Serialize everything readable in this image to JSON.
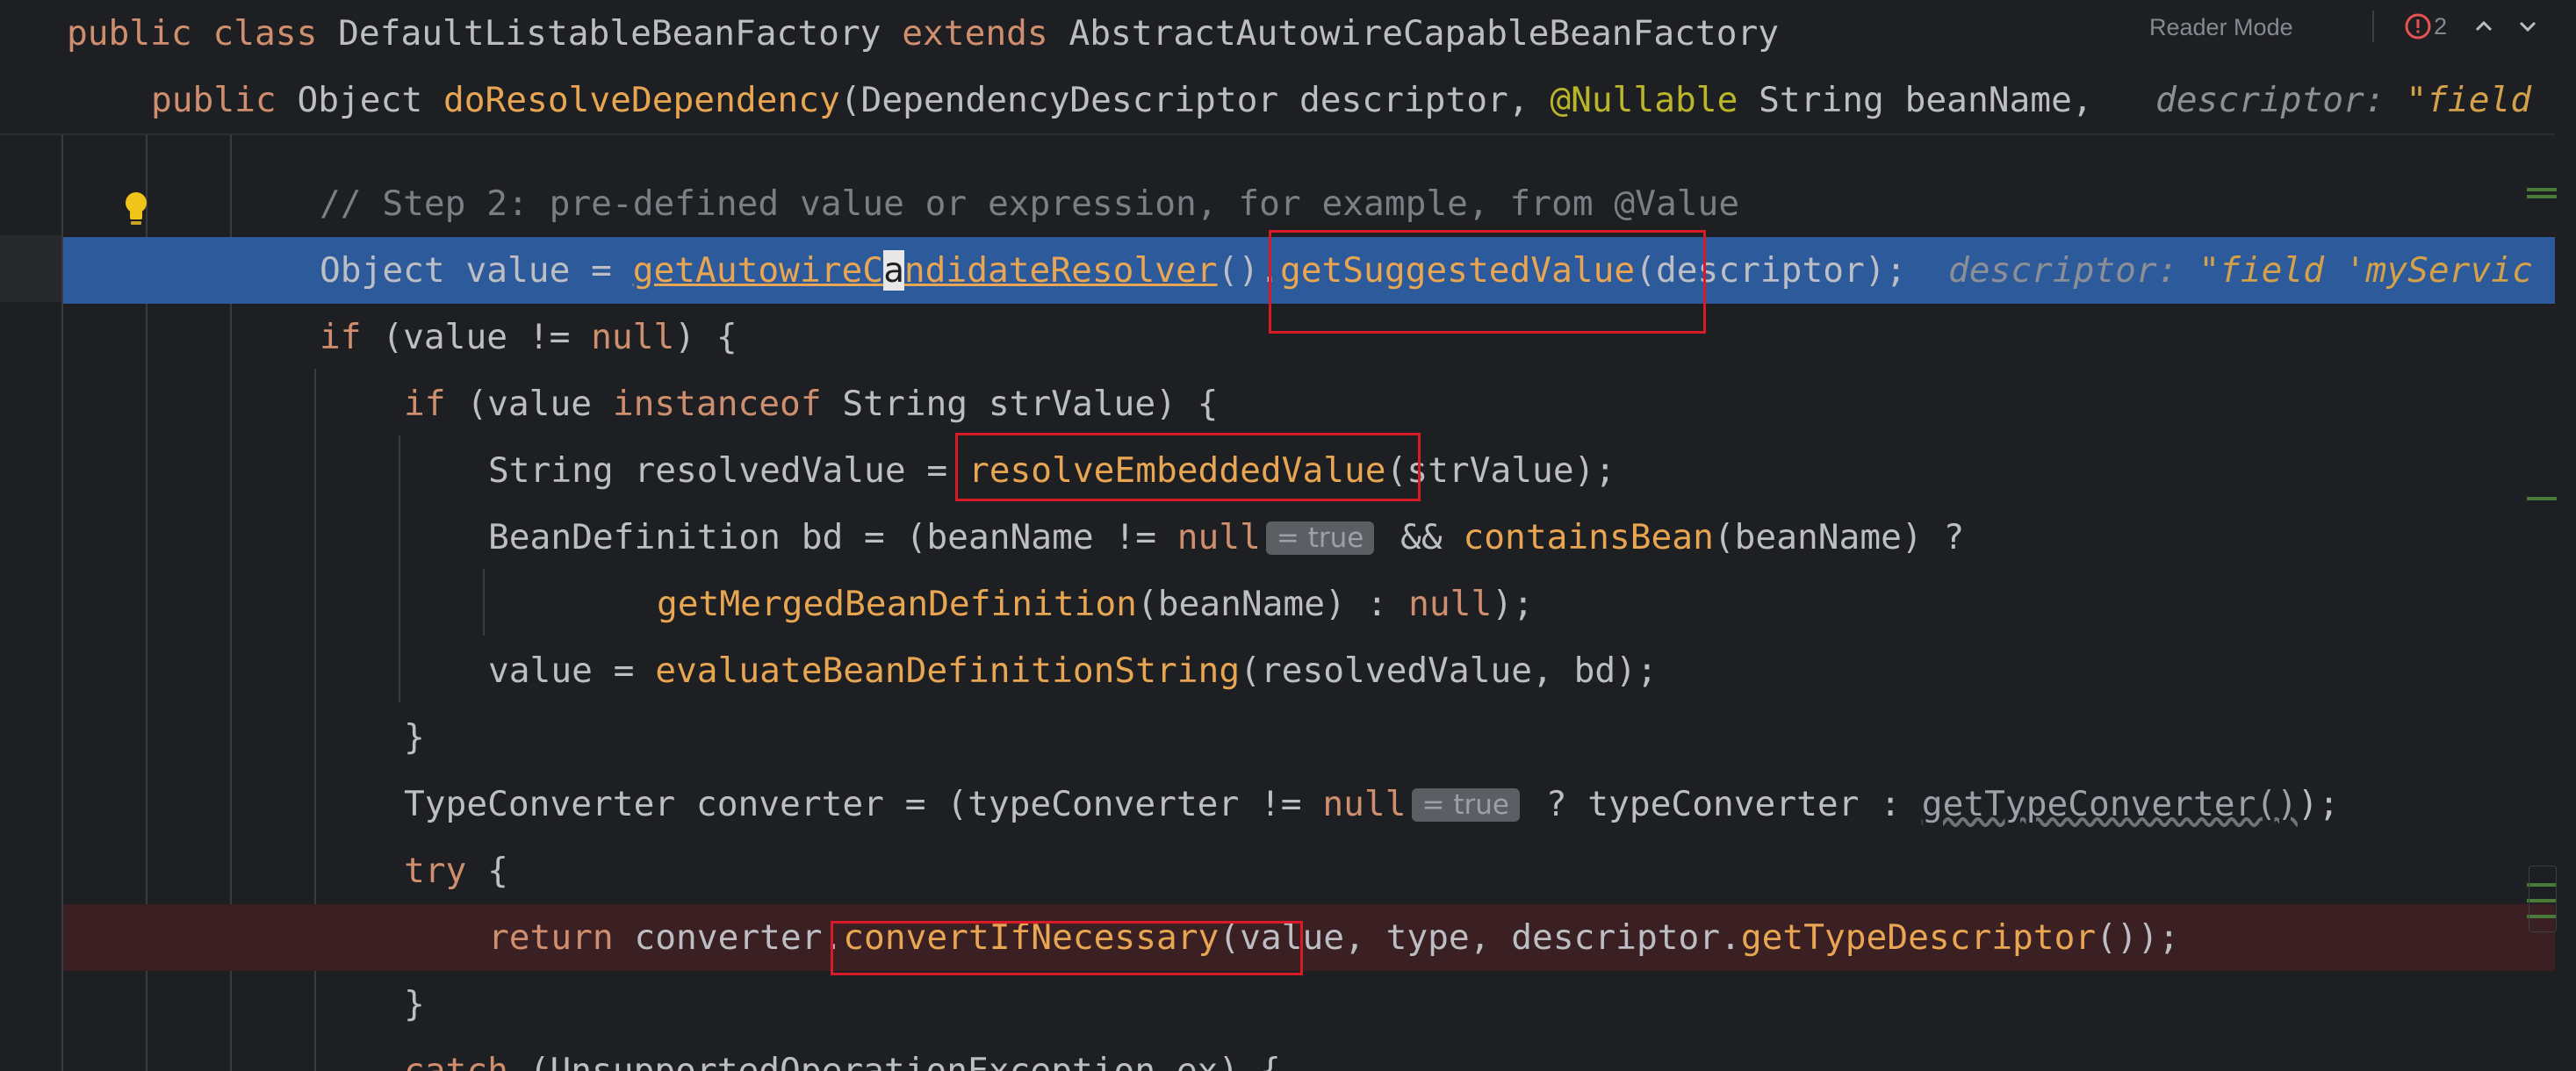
{
  "toolbar": {
    "reader_mode": "Reader Mode",
    "error_count": "2",
    "icons": {
      "error": "error-circle-icon",
      "up": "chevron-up-icon",
      "down": "chevron-down-icon",
      "bulb": "lightbulb-icon"
    }
  },
  "sticky": {
    "line1": {
      "kw1": "public",
      "kw2": "class",
      "name": " DefaultListableBeanFactory ",
      "kw3": "extends",
      "parent": " AbstractAutowireCapableBeanFactory"
    },
    "line2": {
      "kw1": "public",
      "t1": " Object ",
      "method": "doResolveDependency",
      "t2": "(DependencyDescriptor descriptor, ",
      "ann": "@Nullable",
      "t3": " String beanName,",
      "hint_label": "descriptor: ",
      "hint_value": "\"field"
    }
  },
  "code": {
    "l1": {
      "comment": "// Step 2: pre-defined value or expression, for example, from @Value"
    },
    "l2": {
      "t1": "Object value = ",
      "fn1a": "getAutowireC",
      "cursor": "a",
      "fn1b": "ndidateResolver",
      "t2": "()",
      "t3": ".",
      "fn2": "getSuggestedValue",
      "t4": "(descriptor);",
      "hint_label": "descriptor: ",
      "hint_value": "\"field 'myServic"
    },
    "l3": {
      "kw": "if",
      "t1": " (value != ",
      "kw2": "null",
      "t2": ") {"
    },
    "l4": {
      "kw": "if",
      "t1": " (value ",
      "kw2": "instanceof",
      "t2": " String strValue) {"
    },
    "l5": {
      "t1": "String resolvedValue = ",
      "fn": "resolveEmbeddedValue",
      "t2": "(strValue);"
    },
    "l6": {
      "t1": "BeanDefinition bd = (beanName != ",
      "kw": "null",
      "chip": "= true",
      "t2": " && ",
      "fn": "containsBean",
      "t3": "(beanName) ?"
    },
    "l7": {
      "fn": "getMergedBeanDefinition",
      "t1": "(beanName) : ",
      "kw": "null",
      "t2": ");"
    },
    "l8": {
      "t1": "value = ",
      "fn": "evaluateBeanDefinitionString",
      "t2": "(resolvedValue, bd);"
    },
    "l9": {
      "t1": "}"
    },
    "l10": {
      "t1": "TypeConverter converter = (typeConverter != ",
      "kw": "null",
      "chip": "= true",
      "t2": " ? typeConverter : ",
      "dep": "getTypeConverter()",
      "t3": ");"
    },
    "l11": {
      "kw": "try",
      "t1": " {"
    },
    "l12": {
      "kw": "return",
      "t1": " converter",
      "t2": ".",
      "fn": "convertIfNecessary",
      "t3": "(value, type, descriptor.",
      "fn2": "getTypeDescriptor",
      "t4": "());"
    },
    "l13": {
      "t1": "}"
    },
    "l14": {
      "kw": "catch",
      "t1": " (UnsupportedOperationException ex) {"
    }
  }
}
